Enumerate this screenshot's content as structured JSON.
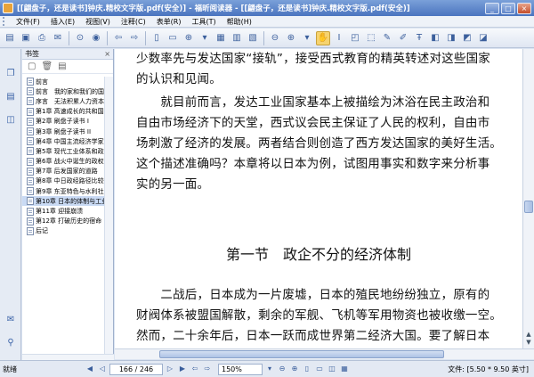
{
  "window": {
    "title": "[[翩盘子，还是读书]钟庆.精校文字版.pdf(安全)] - 福昕阅读器 - [[翩盘子，还是读书]钟庆.精校文字版.pdf(安全)]"
  },
  "menu": [
    "文件(F)",
    "插入(E)",
    "视图(V)",
    "注释(C)",
    "表单(R)",
    "工具(T)",
    "帮助(H)"
  ],
  "bookmarks_panel": {
    "title": "书签",
    "items": [
      "前言",
      "前言　我的家和我们的国",
      "序言　无法积累人力资本",
      "第1章 高速成长的共和国",
      "第2章 刷盘子读书 I",
      "第3章 刷盘子读书 II",
      "第4章 中国主流经济学家",
      "第5章 现代工业体系和政",
      "第6章 战火中诞生的政权",
      "第7章 后发国家的道路",
      "第8章 中日政经路径比较",
      "第9章 东亚特色与水利社",
      "第10章 日本的体制与工业",
      "第11章 迎接崩溃",
      "第12章 打破历史的宿命",
      "后记"
    ],
    "selected_index": 12
  },
  "document": {
    "para1_lines": [
      "少数率先与发达国家“接轨”，接受西式教育的精英转述对这些国家",
      "的认识和见闻。"
    ],
    "para2_lines": [
      "　　就目前而言，发达工业国家基本上被描绘为沐浴在民主政治和",
      "自由市场经济下的天堂，西式议会民主保证了人民的权利，自由市",
      "场刺激了经济的发展。两者结合则创造了西方发达国家的美好生活。",
      "这个描述准确吗？本章将以日本为例，试图用事实和数字来分析事",
      "实的另一面。"
    ],
    "heading": "第一节　政企不分的经济体制",
    "para3_lines": [
      "　　二战后，日本成为一片废墟，日本的殖民地纷纷独立，原有的",
      "财阀体系被盟国解散，剩余的军舰、飞机等军用物资也被收缴一空。",
      "然而，二十余年后，日本一跃而成世界第二经济大国。要了解日本"
    ]
  },
  "status": {
    "ready": "就绪",
    "page": "166 / 246",
    "zoom": "150%",
    "file_size": "文件: [5.50 * 9.50 英寸]"
  }
}
